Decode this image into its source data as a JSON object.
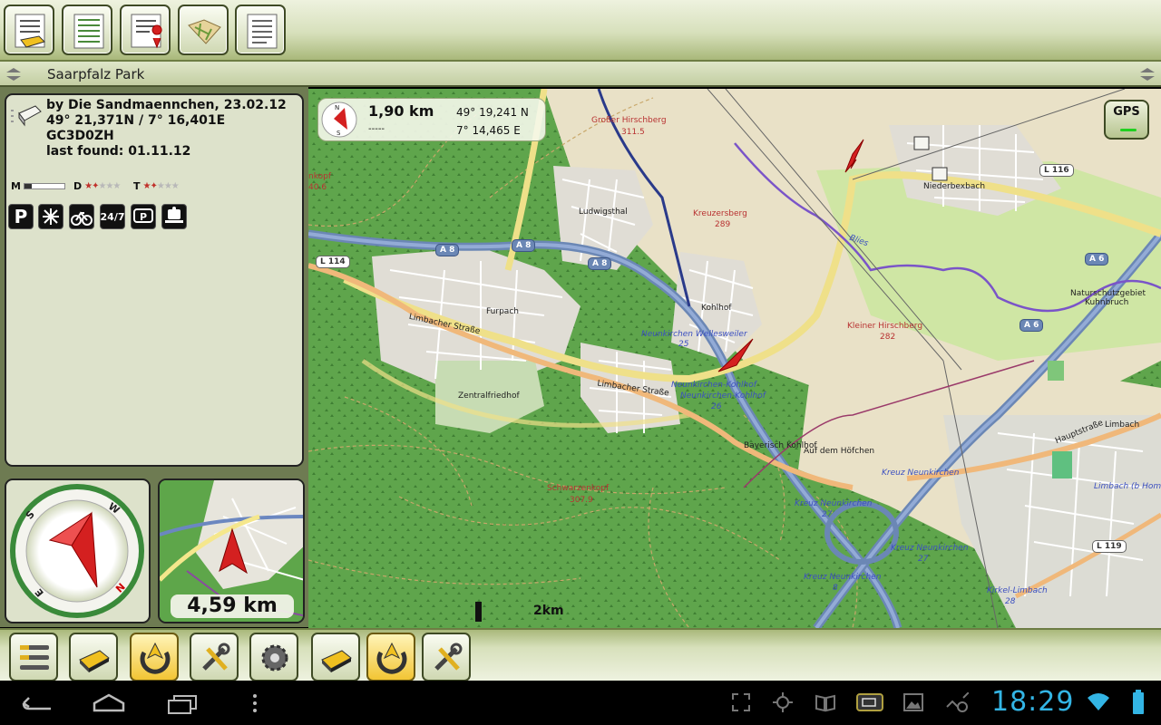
{
  "title_bar": {
    "title": "Saarpfalz Park"
  },
  "top_toolbar": {
    "buttons": [
      "cache-list-icon",
      "cache-list-detailed-icon",
      "cache-map-list-icon",
      "map-icon",
      "notes-icon"
    ]
  },
  "cache": {
    "owner_date": "by Die Sandmaennchen, 23.02.12",
    "coordinates": "49° 21,371N / 7° 16,401E",
    "code": "GC3D0ZH",
    "last_found": "last found: 01.11.12",
    "size_label": "M",
    "difficulty_label": "D",
    "difficulty": 1.5,
    "terrain_label": "T",
    "terrain": 1.5,
    "attributes": [
      "parking-icon",
      "winter-icon",
      "bicycle-icon",
      "available-24-7-icon",
      "parking-lot-icon",
      "public-transport-icon"
    ],
    "attribute_text": {
      "parking": "P",
      "available": "24/7"
    }
  },
  "minimap": {
    "distance": "4,59 km"
  },
  "map": {
    "nav": {
      "distance": "1,90 km",
      "speed": "-----",
      "lat": "49°  19,241 N",
      "lon": "7°  14,465 E"
    },
    "gps_label": "GPS",
    "scale": "2km",
    "places": {
      "grosser_hirschberg": "Großer Hirschberg",
      "grosser_hirschberg_alt": "311.5",
      "kreuzersberg": "Kreuzersberg",
      "kreuzersberg_alt": "289",
      "kleiner_hirschberg": "Kleiner Hirschberg",
      "kleiner_hirschberg_alt": "282",
      "schwarzenkopf": "Schwarzenkopf",
      "schwarzenkopf_alt": "307.9",
      "ludwigsthal": "Ludwigsthal",
      "furpach": "Furpach",
      "kohlhof": "Kohlhof",
      "zentralfriedhof": "Zentralfriedhof",
      "niederbexbach": "Niederbexbach",
      "naturschutzgebiet": "Naturschutzgebiet",
      "kuhnbruch": "Kuhnbruch",
      "limbach": "Limbach",
      "limbacher_strasse_1": "Limbacher Straße",
      "limbacher_strasse_2": "Limbacher Straße",
      "hauptstrasse": "Hauptstraße",
      "bayerisch_kohlhof": "Bayerisch Kohlhof",
      "auf_dem_hoefchen": "Auf dem Höfchen",
      "kopf_partial": "nkopf",
      "kopf_alt": "40.6",
      "blies": "Blies",
      "nk_wellesweiler": "Neunkirchen Wellesweiler",
      "nk_wellesweiler_num": "25",
      "nk_kohlhof": "Neunkirchen-Kohlhof",
      "nk_kohlhof2": "Neunkirchen-Kohlhof",
      "nk_kohlhof_num": "26",
      "kreuz_neunkirchen_1": "Kreuz Neunkirchen",
      "kreuz_neunkirchen_2": "Kreuz Neunkirchen",
      "kreuz_neunkirchen_num": "27",
      "kreuz_neunkirchen_3": "Kreuz Neunkirchen",
      "kreuz_neunkirchen_3_num": "27",
      "kreuz_neunkirchen_4": "Kreuz Neunkirchen",
      "kreuz_neunkirchen_4_num": "8",
      "kirkel_limbach": "Kirkel-Limbach",
      "kirkel_limbach_num": "28",
      "limbach_homburg": "Limbach (b Hombu"
    },
    "road_shields": {
      "a8_1": "A 8",
      "a8_2": "A 8",
      "a8_3": "A 8",
      "a6_1": "A 6",
      "a6_2": "A 6",
      "l114": "L 114",
      "l116": "L 116",
      "l119": "L 119"
    }
  },
  "bottom_toolbar": {
    "buttons": [
      "menu-icon",
      "cache-icon",
      "navigate-active-icon",
      "tools-icon",
      "settings-icon",
      "cache-icon-2",
      "navigate-active-icon-2",
      "tools-icon-2"
    ]
  },
  "system_bar": {
    "clock": "18:29",
    "nav_icons": [
      "back-icon",
      "home-icon",
      "recent-apps-icon",
      "overflow-menu-icon"
    ],
    "status_icons": [
      "screen-expand-icon",
      "gps-icon",
      "book-icon",
      "battery-app-icon",
      "gallery-icon",
      "wifi-tethering-icon",
      "wifi-icon",
      "battery-icon"
    ]
  },
  "colors": {
    "toolbar_green": "#d7e0bb",
    "map_forest": "#5fa54c",
    "clock_blue": "#33b5e5",
    "accent_yellow": "#f2c534",
    "arrow_red": "#d42020"
  }
}
